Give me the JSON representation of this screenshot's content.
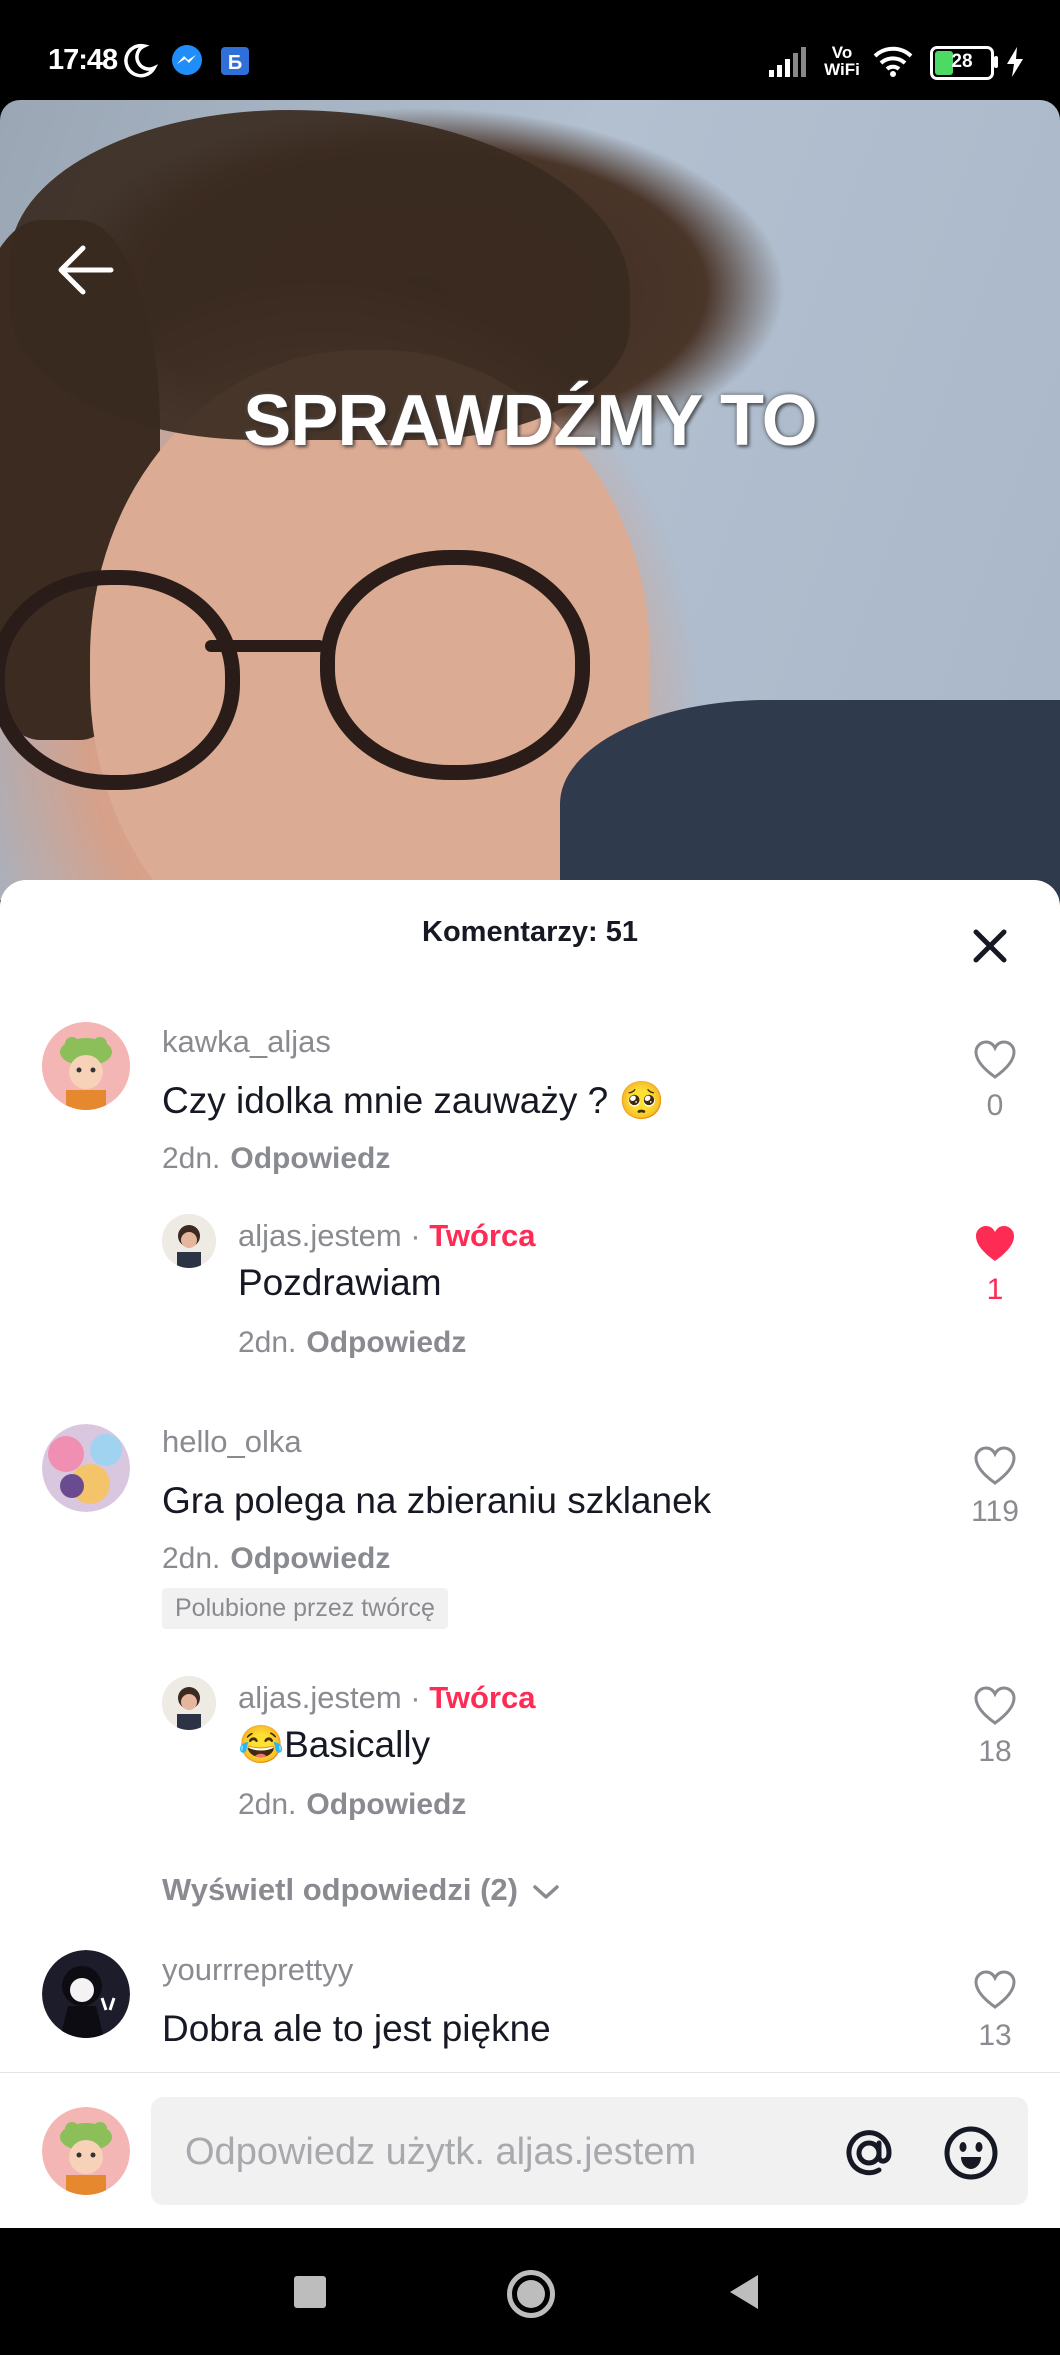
{
  "status_bar": {
    "time": "17:48",
    "network_label_top": "Vo",
    "network_label_bottom": "WiFi",
    "battery": "28"
  },
  "video": {
    "overlay_text": "SPRAWDŹMY TO"
  },
  "comments_sheet": {
    "title": "Komentarzy: 51",
    "comments": [
      {
        "username": "kawka_aljas",
        "text": "Czy idolka mnie zauważy ? 🥺",
        "date": "2dn.",
        "reply_label": "Odpowiedz",
        "likes": "0",
        "liked": false
      },
      {
        "username": "aljas.jestem",
        "creator_label": "Twórca",
        "text": "Pozdrawiam",
        "date": "2dn.",
        "reply_label": "Odpowiedz",
        "likes": "1",
        "liked": true
      },
      {
        "username": "hello_olka",
        "text": "Gra polega na zbieraniu szklanek",
        "date": "2dn.",
        "reply_label": "Odpowiedz",
        "likes": "119",
        "liked": false,
        "badge": "Polubione przez twórcę"
      },
      {
        "username": "aljas.jestem",
        "creator_label": "Twórca",
        "text": "😂Basically",
        "date": "2dn.",
        "reply_label": "Odpowiedz",
        "likes": "18",
        "liked": false
      },
      {
        "username": "yourrreprettyy",
        "text": "Dobra ale to jest piękne",
        "likes": "13",
        "liked": false
      }
    ],
    "view_replies": "Wyświetl odpowiedzi (2)"
  },
  "input_bar": {
    "placeholder": "Odpowiedz użytk. aljas.jestem"
  },
  "colors": {
    "accent": "#fe2c55",
    "muted": "#8a8b91",
    "text": "#161823"
  }
}
